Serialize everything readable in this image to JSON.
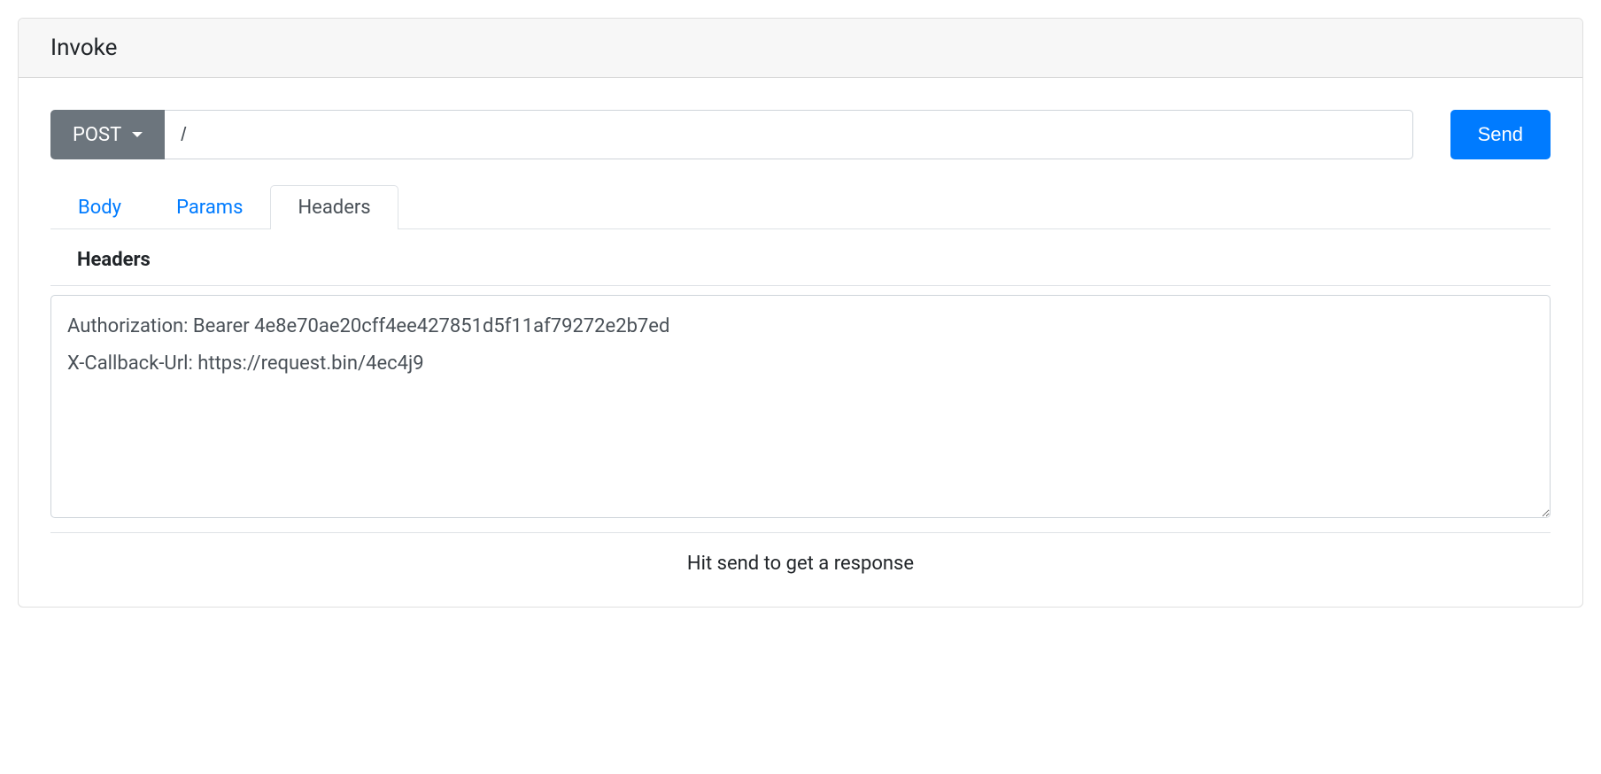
{
  "panel": {
    "title": "Invoke"
  },
  "request": {
    "method": "POST",
    "url": "/",
    "send_label": "Send"
  },
  "tabs": {
    "body": "Body",
    "params": "Params",
    "headers": "Headers",
    "active": "headers"
  },
  "headers_section": {
    "title": "Headers",
    "value": "Authorization: Bearer 4e8e70ae20cff4ee427851d5f11af79272e2b7ed\nX-Callback-Url: https://request.bin/4ec4j9"
  },
  "response": {
    "placeholder": "Hit send to get a response"
  }
}
